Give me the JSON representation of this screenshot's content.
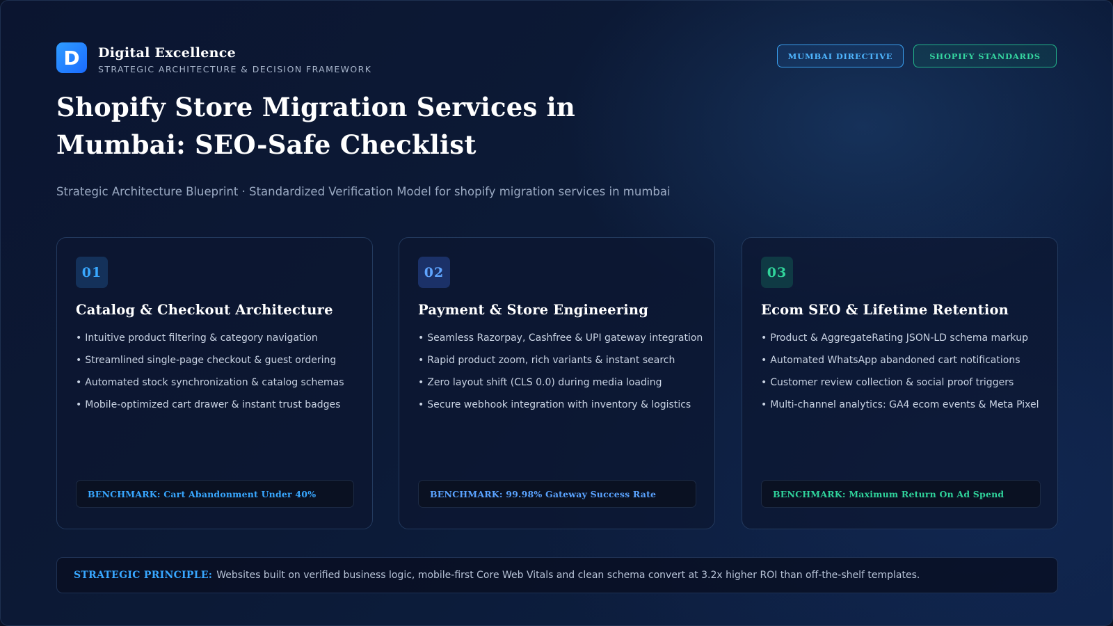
{
  "brand": {
    "logo_letter": "D",
    "name": "Digital Excellence",
    "tagline": "STRATEGIC ARCHITECTURE & DECISION FRAMEWORK"
  },
  "tags": [
    "MUMBAI DIRECTIVE",
    "SHOPIFY STANDARDS"
  ],
  "title": {
    "line1": "Shopify Store Migration Services in",
    "line2": "Mumbai: SEO-Safe Checklist"
  },
  "subtitle": "Strategic Architecture Blueprint · Standardized Verification Model for shopify migration services in mumbai",
  "cards": [
    {
      "number": "01",
      "title": "Catalog & Checkout Architecture",
      "items": [
        "Intuitive product filtering & category navigation",
        "Streamlined single-page checkout & guest ordering",
        "Automated stock synchronization & catalog schemas",
        "Mobile-optimized cart drawer & instant trust badges"
      ],
      "benchmark": "BENCHMARK: Cart Abandonment Under 40%"
    },
    {
      "number": "02",
      "title": "Payment & Store Engineering",
      "items": [
        "Seamless Razorpay, Cashfree & UPI gateway integration",
        "Rapid product zoom, rich variants & instant search",
        "Zero layout shift (CLS 0.0) during media loading",
        "Secure webhook integration with inventory & logistics"
      ],
      "benchmark": "BENCHMARK: 99.98% Gateway Success Rate"
    },
    {
      "number": "03",
      "title": "Ecom SEO & Lifetime Retention",
      "items": [
        "Product & AggregateRating JSON-LD schema markup",
        "Automated WhatsApp abandoned cart notifications",
        "Customer review collection & social proof triggers",
        "Multi-channel analytics: GA4 ecom events & Meta Pixel"
      ],
      "benchmark": "BENCHMARK: Maximum Return On Ad Spend"
    }
  ],
  "principle": {
    "label": "STRATEGIC PRINCIPLE:",
    "text": "Websites built on verified business logic, mobile-first Core Web Vitals and clean schema convert at 3.2x higher ROI than off-the-shelf templates."
  },
  "colors": {
    "accent_blue": "#38a7ff",
    "accent_green": "#2fd19a",
    "background": "#0c1a36"
  }
}
